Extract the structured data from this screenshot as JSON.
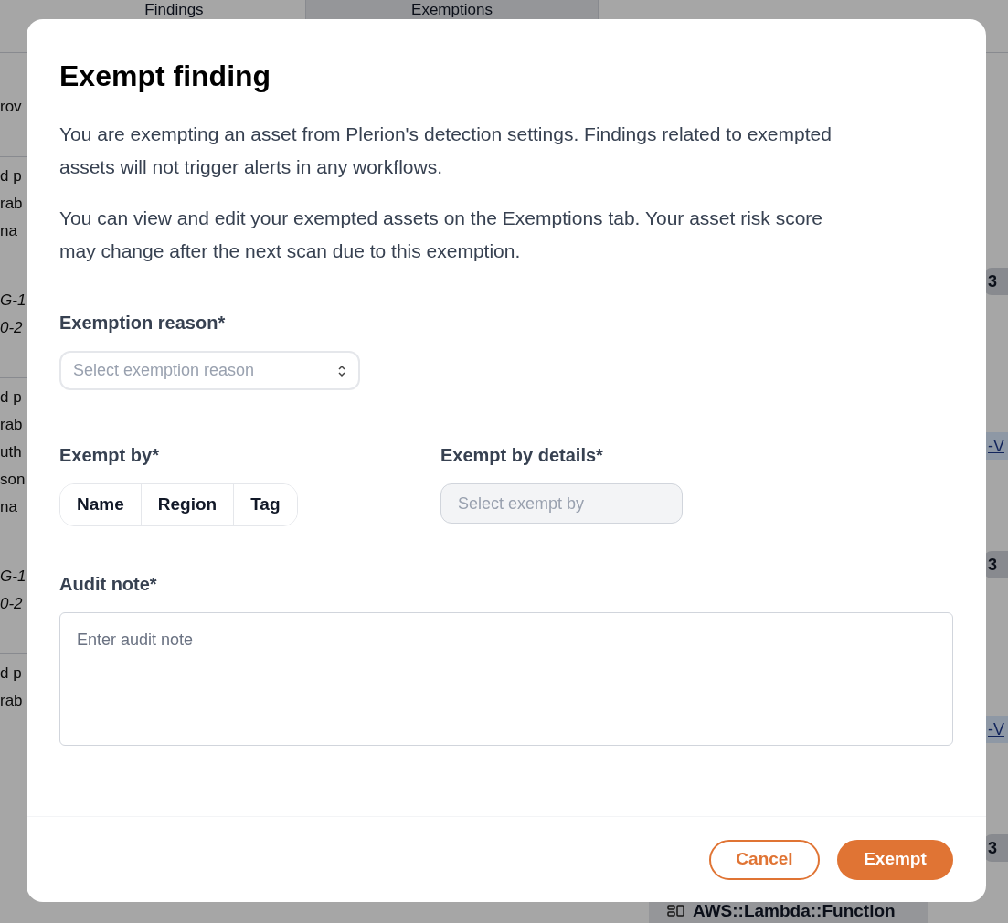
{
  "background": {
    "tabs": [
      {
        "label": "Findings",
        "selected": true
      },
      {
        "label": "Exemptions",
        "selected": false
      }
    ],
    "left_rows": [
      {
        "kind": "text",
        "lines": [
          "rov"
        ]
      },
      {
        "kind": "text",
        "lines": [
          "d p",
          "rab",
          "na"
        ]
      },
      {
        "kind": "code",
        "lines": [
          "G-1",
          "0-2"
        ]
      },
      {
        "kind": "text",
        "lines": [
          "d p",
          "rab",
          "uth",
          "son",
          "na"
        ]
      },
      {
        "kind": "code",
        "lines": [
          "G-1",
          "0-2"
        ]
      },
      {
        "kind": "text",
        "lines": [
          "d p",
          "rab"
        ]
      }
    ],
    "right_items": [
      {
        "kind": "badge",
        "text": "3"
      },
      {
        "kind": "link",
        "text": "-V"
      },
      {
        "kind": "badge",
        "text": "3"
      },
      {
        "kind": "link",
        "text": "-V"
      },
      {
        "kind": "badge",
        "text": "3"
      }
    ],
    "resource_chip": "AWS::Lambda::Function"
  },
  "dialog": {
    "title": "Exempt finding",
    "paragraphs": [
      "You are exempting an asset from Plerion's detection settings. Findings related to exempted assets will not trigger alerts in any workflows.",
      "You can view and edit your exempted assets on the Exemptions tab. Your asset risk score may change after the next scan due to this exemption."
    ],
    "reason": {
      "label": "Exemption reason*",
      "placeholder": "Select exemption reason"
    },
    "exempt_by": {
      "label": "Exempt by*",
      "options": [
        {
          "label": "Name",
          "selected": false
        },
        {
          "label": "Region",
          "selected": false
        },
        {
          "label": "Tag",
          "selected": false
        }
      ]
    },
    "details": {
      "label": "Exempt by details*",
      "placeholder": "Select exempt by",
      "disabled": true
    },
    "audit_note": {
      "label": "Audit note*",
      "placeholder": "Enter audit note"
    },
    "buttons": [
      {
        "label": "Cancel",
        "kind": "secondary"
      },
      {
        "label": "Exempt",
        "kind": "primary"
      }
    ]
  }
}
